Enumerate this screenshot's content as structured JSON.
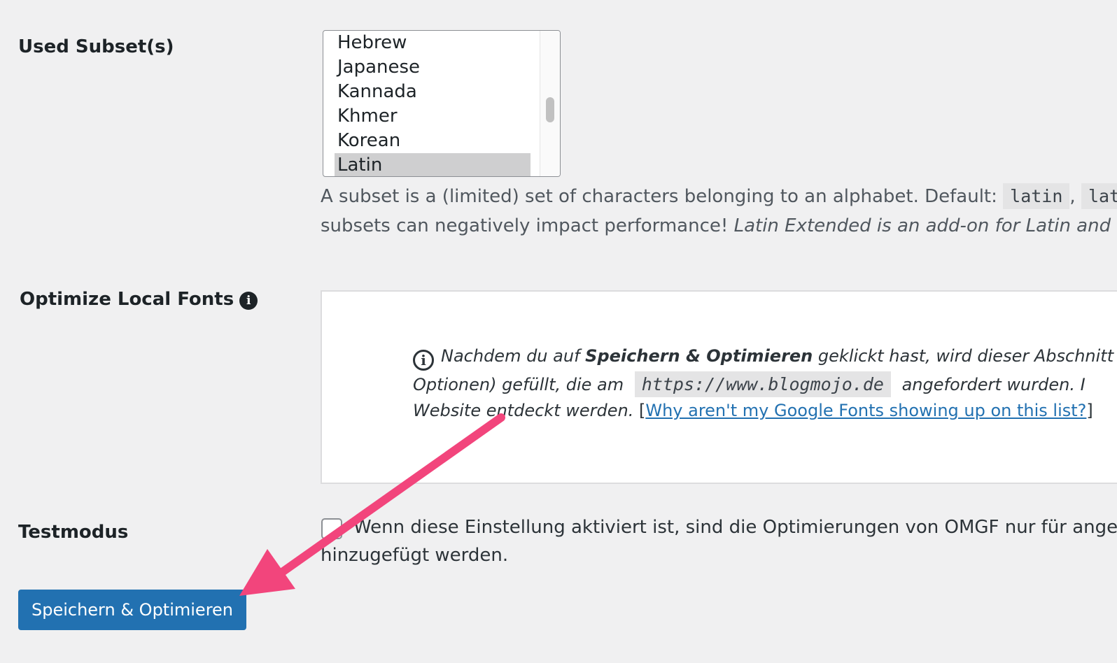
{
  "subsets": {
    "label": "Used Subset(s)",
    "options": [
      "Hebrew",
      "Japanese",
      "Kannada",
      "Khmer",
      "Korean",
      "Latin"
    ],
    "selected": "Latin",
    "description": {
      "line1_text": "A subset is a (limited) set of characters belonging to an alphabet. Default:",
      "code1": "latin",
      "separator": ",",
      "code2": "lat",
      "line2_text": "subsets can negatively impact performance!",
      "line2_italic": "Latin Extended is an add-on for Latin and c"
    }
  },
  "optimize": {
    "label": "Optimize Local Fonts",
    "info_icon": "info-icon",
    "notice": {
      "part1": "Nachdem du auf",
      "bold": "Speichern & Optimieren",
      "part2": "geklickt hast, wird dieser Abschnitt",
      "line2_start": "Optionen) gefüllt, die am",
      "url": "https://www.blogmojo.de",
      "line2_end": "angefordert wurden.",
      "line2_tail": "I",
      "line3_start": "Website entdeckt werden.",
      "bracket_open": "[",
      "link_text": "Why aren't my Google Fonts showing up on this list?",
      "bracket_close": "]"
    }
  },
  "testmode": {
    "label": "Testmodus",
    "checked": false,
    "description_line1": "Wenn diese Einstellung aktiviert ist, sind die Optimierungen von OMGF nur für anger",
    "description_line2": "hinzugefügt werden."
  },
  "save_button": "Speichern & Optimieren",
  "colors": {
    "background": "#f0f0f1",
    "button": "#2271b1",
    "link": "#2271b1",
    "annotation_arrow": "#f2457c"
  }
}
